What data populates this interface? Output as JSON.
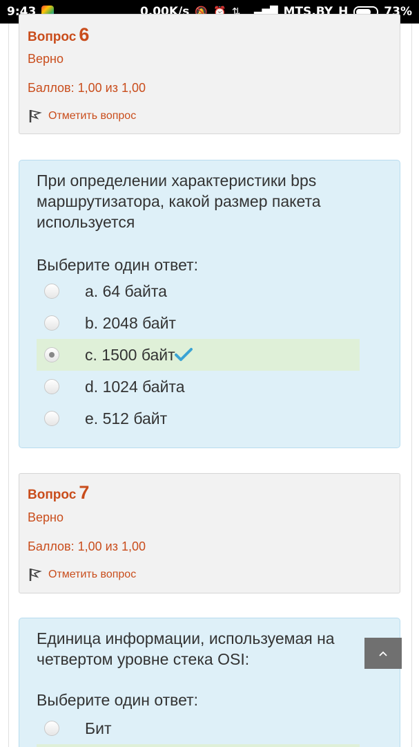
{
  "status_bar": {
    "time": "9:43",
    "speed": "0.00K/s",
    "carrier": "MTS.BY",
    "network_type": "H",
    "battery": "73%",
    "battery_level": 0.73
  },
  "questions": [
    {
      "label": "Вопрос",
      "number": "6",
      "state": "Верно",
      "grade": "Баллов: 1,00 из 1,00",
      "flag_label": "Отметить вопрос",
      "text": "При определении характеристики bps маршрутизатора, какой размер пакета используется",
      "prompt": "Выберите один ответ:",
      "answers": [
        {
          "label": "a. 64 байта",
          "checked": false,
          "correct": false
        },
        {
          "label": "b. 2048 байт",
          "checked": false,
          "correct": false
        },
        {
          "label": "c. 1500 байт",
          "checked": true,
          "correct": true
        },
        {
          "label": "d. 1024 байта",
          "checked": false,
          "correct": false
        },
        {
          "label": "e. 512 байт",
          "checked": false,
          "correct": false
        }
      ]
    },
    {
      "label": "Вопрос",
      "number": "7",
      "state": "Верно",
      "grade": "Баллов: 1,00 из 1,00",
      "flag_label": "Отметить вопрос",
      "text": "Единица информации, используемая на четвертом уровне стека OSI:",
      "prompt": "Выберите один ответ:",
      "answers": [
        {
          "label": "Бит",
          "checked": false,
          "correct": false
        }
      ]
    }
  ],
  "colors": {
    "accent": "#c94d1c",
    "info_bg": "#f2f2f2",
    "content_bg": "#def0f8",
    "correct_bg": "#dff0d8",
    "check": "#3aa3d4"
  },
  "icons": {
    "flag": "flag-icon",
    "check": "check-icon",
    "scroll_top": "chevron-up-icon"
  }
}
